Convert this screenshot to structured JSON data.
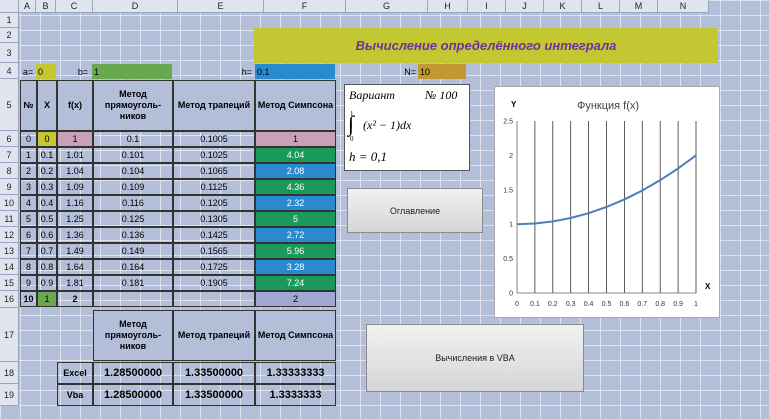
{
  "columns": [
    "",
    "A",
    "B",
    "C",
    "D",
    "E",
    "F",
    "G",
    "H",
    "I",
    "J",
    "K",
    "L",
    "M",
    "N"
  ],
  "rows": [
    "1",
    "2",
    "3",
    "4",
    "5",
    "6",
    "7",
    "8",
    "9",
    "10",
    "11",
    "12",
    "13",
    "14",
    "15",
    "16",
    "17",
    "18",
    "19"
  ],
  "title": "Вычисление определённого интеграла",
  "params": {
    "a_label": "a=",
    "a_value": "0",
    "b_label": "b=",
    "b_value": "1",
    "h_label": "h=",
    "h_value": "0.1",
    "n_label": "N=",
    "n_value": "10"
  },
  "table": {
    "headers": [
      "№",
      "X",
      "f(x)",
      "Метод прямоуголь-ников",
      "Метод трапеций",
      "Метод Симпсона"
    ],
    "rows": [
      [
        "0",
        "0",
        "1",
        "0.1",
        "0.1005",
        "1"
      ],
      [
        "1",
        "0.1",
        "1.01",
        "0.101",
        "0.1025",
        "4.04"
      ],
      [
        "2",
        "0.2",
        "1.04",
        "0.104",
        "0.1065",
        "2.08"
      ],
      [
        "3",
        "0.3",
        "1.09",
        "0.109",
        "0.1125",
        "4.36"
      ],
      [
        "4",
        "0.4",
        "1.16",
        "0.116",
        "0.1205",
        "2.32"
      ],
      [
        "5",
        "0.5",
        "1.25",
        "0.125",
        "0.1305",
        "5"
      ],
      [
        "6",
        "0.6",
        "1.36",
        "0.136",
        "0.1425",
        "2.72"
      ],
      [
        "7",
        "0.7",
        "1.49",
        "0.149",
        "0.1565",
        "5.96"
      ],
      [
        "8",
        "0.8",
        "1.64",
        "0.164",
        "0.1725",
        "3.28"
      ],
      [
        "9",
        "0.9",
        "1.81",
        "0.181",
        "0.1905",
        "7.24"
      ],
      [
        "10",
        "1",
        "2",
        "",
        "",
        "2"
      ]
    ],
    "simpson_colors": [
      "#c8a0b8",
      "#1a9a5a",
      "#2a8ad0",
      "#1a9a5a",
      "#2a8ad0",
      "#1a9a5a",
      "#2a8ad0",
      "#1a9a5a",
      "#2a8ad0",
      "#1a9a5a",
      "#b3bfd9"
    ]
  },
  "results": {
    "headers": [
      "Метод прямоуголь-ников",
      "Метод трапеций",
      "Метод Симпсона"
    ],
    "excel_label": "Excel",
    "vba_label": "Vba",
    "excel": [
      "1.28500000",
      "1.33500000",
      "1.33333333"
    ],
    "vba": [
      "1.28500000",
      "1.33500000",
      "1.3333333"
    ]
  },
  "variant": {
    "word": "Вариант",
    "number": "№ 100",
    "upper": "1",
    "lower": "0",
    "integrand": "(x² − 1)dx",
    "h": "h =  0,1"
  },
  "buttons": {
    "contents": "Оглавление",
    "vba": "Вычисления в VBA"
  },
  "chart_data": {
    "type": "line",
    "title": "Функция f(x)",
    "xlabel": "X",
    "ylabel": "Y",
    "x": [
      0,
      0.1,
      0.2,
      0.3,
      0.4,
      0.5,
      0.6,
      0.7,
      0.8,
      0.9,
      1
    ],
    "series": [
      {
        "values": [
          1,
          1.01,
          1.04,
          1.09,
          1.16,
          1.25,
          1.36,
          1.49,
          1.64,
          1.81,
          2
        ]
      }
    ],
    "xticks": [
      "0",
      "0.1",
      "0.2",
      "0.3",
      "0.4",
      "0.5",
      "0.6",
      "0.7",
      "0.8",
      "0.9",
      "1"
    ],
    "yticks": [
      "0",
      "0.5",
      "1",
      "1.5",
      "2",
      "2.5"
    ],
    "ylim": [
      0,
      2.5
    ],
    "xlim": [
      0,
      1
    ],
    "color": "#4a7ebb",
    "grid": "vertical"
  }
}
